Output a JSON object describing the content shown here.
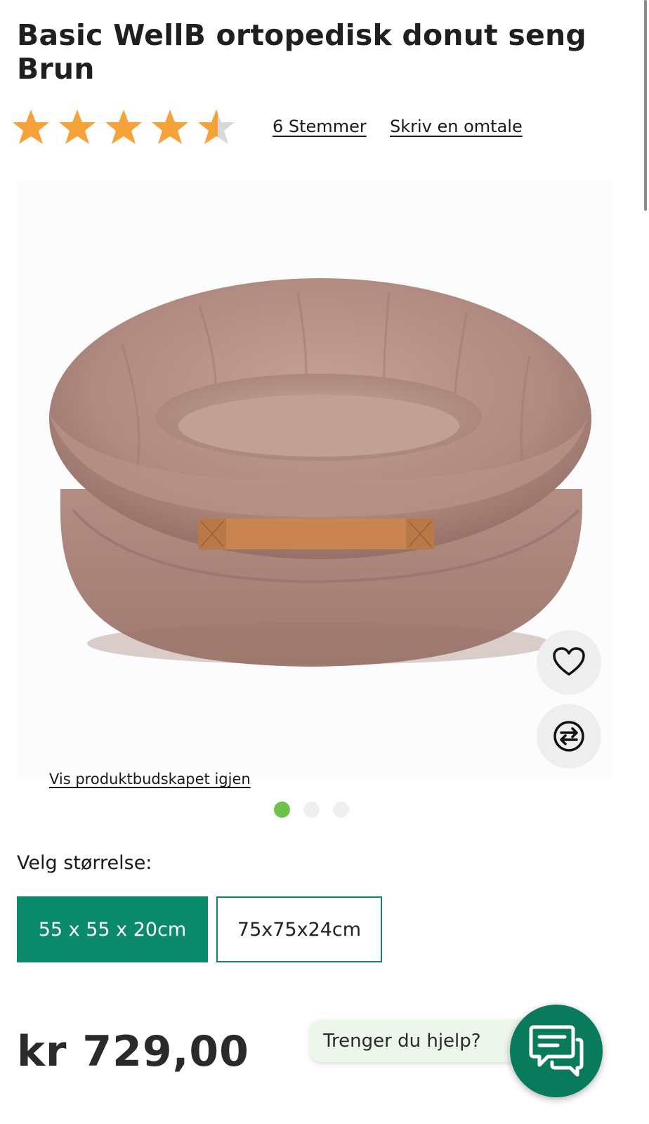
{
  "product": {
    "title": "Basic WellB ortopedisk donut seng Brun",
    "rating_value": 4.5,
    "rating_max": 5,
    "votes_label": "6 Stemmer",
    "review_label": "Skriv en omtale",
    "image_icon": "donut-dog-bed-image"
  },
  "gallery": {
    "show_message_label": "Vis produktbudskapet igjen",
    "slide_count": 3,
    "active_slide": 1,
    "wishlist_icon": "heart-icon",
    "compare_icon": "compare-arrows-icon"
  },
  "size": {
    "label": "Velg størrelse:",
    "options": [
      "55 x 55 x 20cm",
      "75x75x24cm"
    ],
    "selected_index": 0
  },
  "price": {
    "text": "kr 729,00"
  },
  "help": {
    "bubble_text": "Trenger du hjelp?",
    "chat_icon": "chat-icon"
  },
  "colors": {
    "star": "#F5A23A",
    "brand_green": "#0A8A6A",
    "active_dot": "#6CC24A",
    "chat_button": "#0A7A5C"
  }
}
